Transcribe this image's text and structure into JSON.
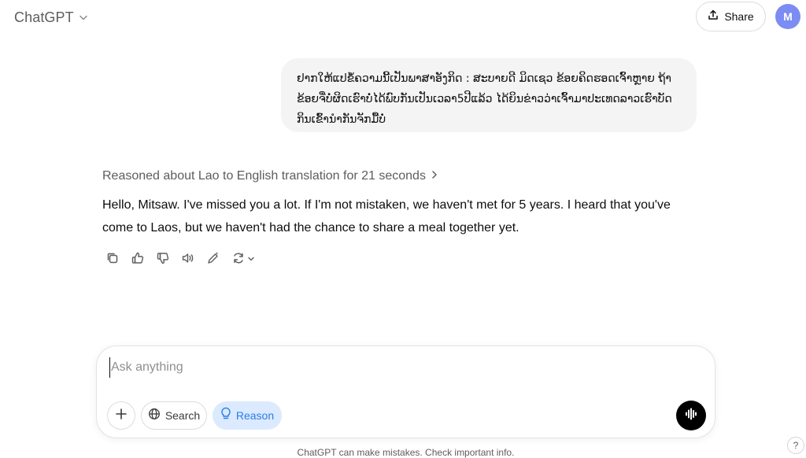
{
  "header": {
    "model_name": "ChatGPT",
    "share_label": "Share",
    "avatar_initial": "M"
  },
  "conversation": {
    "user_message": "ຢາກໃຫ້ແປຂໍ້ຄວາມນີ້ເປັນພາສາອັງກິດ : ສະບາຍດີ ມິດເຊວ ຂ້ອຍຄິດຮອດເຈົ້າຫຼາຍ ຖ້າຂ້ອຍຈື່ບໍ່ຜິດເຮົາບໍ່ໄດ້ພົບກັນເປັນເວລາ5ປີແລ້ວ ໄດ້ຍິນຂ່າວວ່າເຈົ້າມາປະເທດລາວເຮົາບັດກິນເຂົ້ານຳກັນຈັກມື້ບໍ່",
    "reasoning_label": "Reasoned about Lao to English translation for 21 seconds",
    "assistant_reply": "Hello, Mitsaw. I've missed you a lot. If I'm not mistaken, we haven't met for 5 years. I heard that you've come to Laos, but we haven't had the chance to share a meal together yet."
  },
  "message_actions": [
    {
      "icon": "copy-icon"
    },
    {
      "icon": "thumbs-up-icon"
    },
    {
      "icon": "thumbs-down-icon"
    },
    {
      "icon": "read-aloud-icon"
    },
    {
      "icon": "edit-in-canvas-icon"
    },
    {
      "icon": "regenerate-icon"
    }
  ],
  "composer": {
    "placeholder": "Ask anything",
    "value": "",
    "search_label": "Search",
    "reason_label": "Reason"
  },
  "footer": {
    "disclaimer": "ChatGPT can make mistakes. Check important info.",
    "help_label": "?"
  },
  "colors": {
    "accent_reason": "#2b7de9",
    "reason_bg": "#dbeafe",
    "avatar_bg": "#7b8cf2",
    "bubble_bg": "#f4f4f4"
  }
}
